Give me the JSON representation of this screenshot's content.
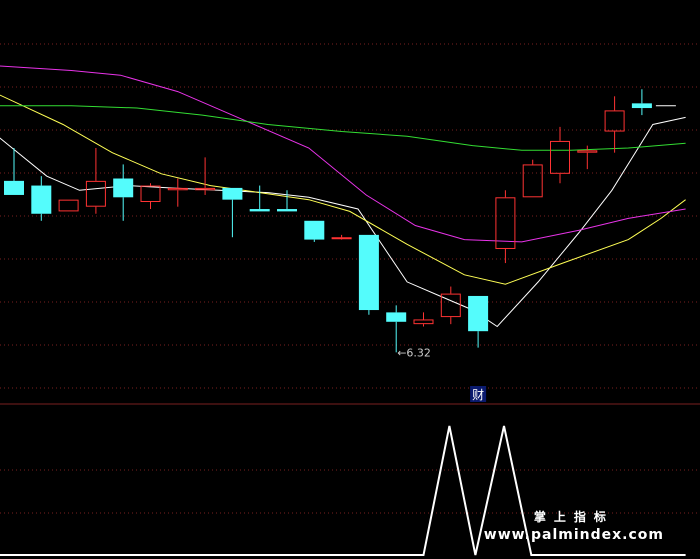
{
  "chart_data": {
    "type": "candlestick",
    "price_ylim": [
      6.1,
      7.82
    ],
    "candles": [
      {
        "o": 7.05,
        "h": 7.19,
        "l": 6.99,
        "c": 6.99
      },
      {
        "o": 7.03,
        "h": 7.07,
        "l": 6.88,
        "c": 6.91
      },
      {
        "o": 6.92,
        "h": 6.97,
        "l": 6.92,
        "c": 6.97
      },
      {
        "o": 6.94,
        "h": 7.19,
        "l": 6.91,
        "c": 7.05
      },
      {
        "o": 7.06,
        "h": 7.12,
        "l": 6.88,
        "c": 6.98
      },
      {
        "o": 6.96,
        "h": 7.04,
        "l": 6.93,
        "c": 7.03
      },
      {
        "o": 7.01,
        "h": 7.06,
        "l": 6.94,
        "c": 7.02
      },
      {
        "o": 7.01,
        "h": 7.15,
        "l": 6.99,
        "c": 7.02
      },
      {
        "o": 7.02,
        "h": 7.02,
        "l": 6.81,
        "c": 6.97
      },
      {
        "o": 6.93,
        "h": 7.03,
        "l": 6.92,
        "c": 6.92
      },
      {
        "o": 6.93,
        "h": 7.01,
        "l": 6.92,
        "c": 6.92
      },
      {
        "o": 6.88,
        "h": 6.88,
        "l": 6.79,
        "c": 6.8
      },
      {
        "o": 6.81,
        "h": 6.82,
        "l": 6.8,
        "c": 6.81
      },
      {
        "o": 6.82,
        "h": 6.82,
        "l": 6.48,
        "c": 6.5
      },
      {
        "o": 6.49,
        "h": 6.52,
        "l": 6.32,
        "c": 6.45
      },
      {
        "o": 6.44,
        "h": 6.49,
        "l": 6.43,
        "c": 6.46
      },
      {
        "o": 6.47,
        "h": 6.6,
        "l": 6.44,
        "c": 6.57
      },
      {
        "o": 6.56,
        "h": 6.56,
        "l": 6.34,
        "c": 6.41
      },
      {
        "o": 6.76,
        "h": 7.01,
        "l": 6.7,
        "c": 6.98
      },
      {
        "o": 6.98,
        "h": 7.14,
        "l": 6.98,
        "c": 7.12
      },
      {
        "o": 7.08,
        "h": 7.28,
        "l": 7.04,
        "c": 7.22
      },
      {
        "o": 7.17,
        "h": 7.2,
        "l": 7.1,
        "c": 7.18
      },
      {
        "o": 7.26,
        "h": 7.41,
        "l": 7.17,
        "c": 7.35
      },
      {
        "o": 7.38,
        "h": 7.44,
        "l": 7.33,
        "c": 7.36
      }
    ],
    "last_price": 7.37,
    "ma_lines": [
      {
        "color": "#ffffff",
        "points": [
          [
            -0.6,
            7.24
          ],
          [
            1.2,
            7.07
          ],
          [
            2.4,
            7.01
          ],
          [
            4.2,
            7.03
          ],
          [
            5.7,
            7.02
          ],
          [
            7.5,
            7.01
          ],
          [
            9.3,
            7.0
          ],
          [
            10.8,
            6.98
          ],
          [
            12.6,
            6.93
          ],
          [
            14.4,
            6.62
          ],
          [
            15.6,
            6.56
          ],
          [
            16.8,
            6.5
          ],
          [
            17.7,
            6.43
          ],
          [
            19.2,
            6.62
          ],
          [
            20.7,
            6.83
          ],
          [
            21.9,
            7.01
          ],
          [
            23.4,
            7.29
          ],
          [
            24.6,
            7.32
          ]
        ]
      },
      {
        "color": "#ffff55",
        "points": [
          [
            -0.6,
            7.42
          ],
          [
            1.8,
            7.29
          ],
          [
            3.6,
            7.17
          ],
          [
            5.4,
            7.08
          ],
          [
            7.2,
            7.03
          ],
          [
            9.0,
            7.0
          ],
          [
            10.8,
            6.97
          ],
          [
            12.3,
            6.92
          ],
          [
            14.4,
            6.78
          ],
          [
            16.5,
            6.65
          ],
          [
            18.0,
            6.61
          ],
          [
            20.1,
            6.7
          ],
          [
            22.5,
            6.8
          ],
          [
            23.7,
            6.89
          ],
          [
            24.6,
            6.97
          ]
        ]
      },
      {
        "color": "#e833e8",
        "points": [
          [
            -0.6,
            7.54
          ],
          [
            2.1,
            7.52
          ],
          [
            3.9,
            7.5
          ],
          [
            6.0,
            7.43
          ],
          [
            8.4,
            7.31
          ],
          [
            10.8,
            7.19
          ],
          [
            12.9,
            6.99
          ],
          [
            14.7,
            6.86
          ],
          [
            16.5,
            6.8
          ],
          [
            18.6,
            6.79
          ],
          [
            20.7,
            6.84
          ],
          [
            22.5,
            6.89
          ],
          [
            24.6,
            6.93
          ]
        ]
      },
      {
        "color": "#33dd33",
        "points": [
          [
            -0.6,
            7.37
          ],
          [
            2.1,
            7.37
          ],
          [
            4.5,
            7.36
          ],
          [
            6.9,
            7.33
          ],
          [
            9.3,
            7.29
          ],
          [
            12.0,
            7.26
          ],
          [
            14.4,
            7.24
          ],
          [
            16.8,
            7.2
          ],
          [
            18.6,
            7.18
          ],
          [
            20.4,
            7.18
          ],
          [
            22.5,
            7.19
          ],
          [
            24.6,
            7.21
          ]
        ]
      }
    ],
    "annotations": {
      "low_label": "←6.32",
      "low_index": 14,
      "event_label": "财",
      "event_index": 17
    },
    "indicator": {
      "ylim": [
        0,
        1
      ],
      "points": [
        [
          -0.6,
          0.0
        ],
        [
          15.0,
          0.0
        ],
        [
          15.95,
          1.0
        ],
        [
          16.9,
          0.0
        ],
        [
          17.95,
          1.0
        ],
        [
          18.95,
          0.0
        ],
        [
          24.6,
          0.0
        ]
      ]
    }
  },
  "colors": {
    "background": "#000000",
    "up": "#ff3333",
    "down": "#54fcfc",
    "grid": "#7a1f1f",
    "indicator": "#ffffff"
  },
  "watermark": {
    "cn_text": "掌上指标",
    "url_text": "www.palmindex.com"
  }
}
